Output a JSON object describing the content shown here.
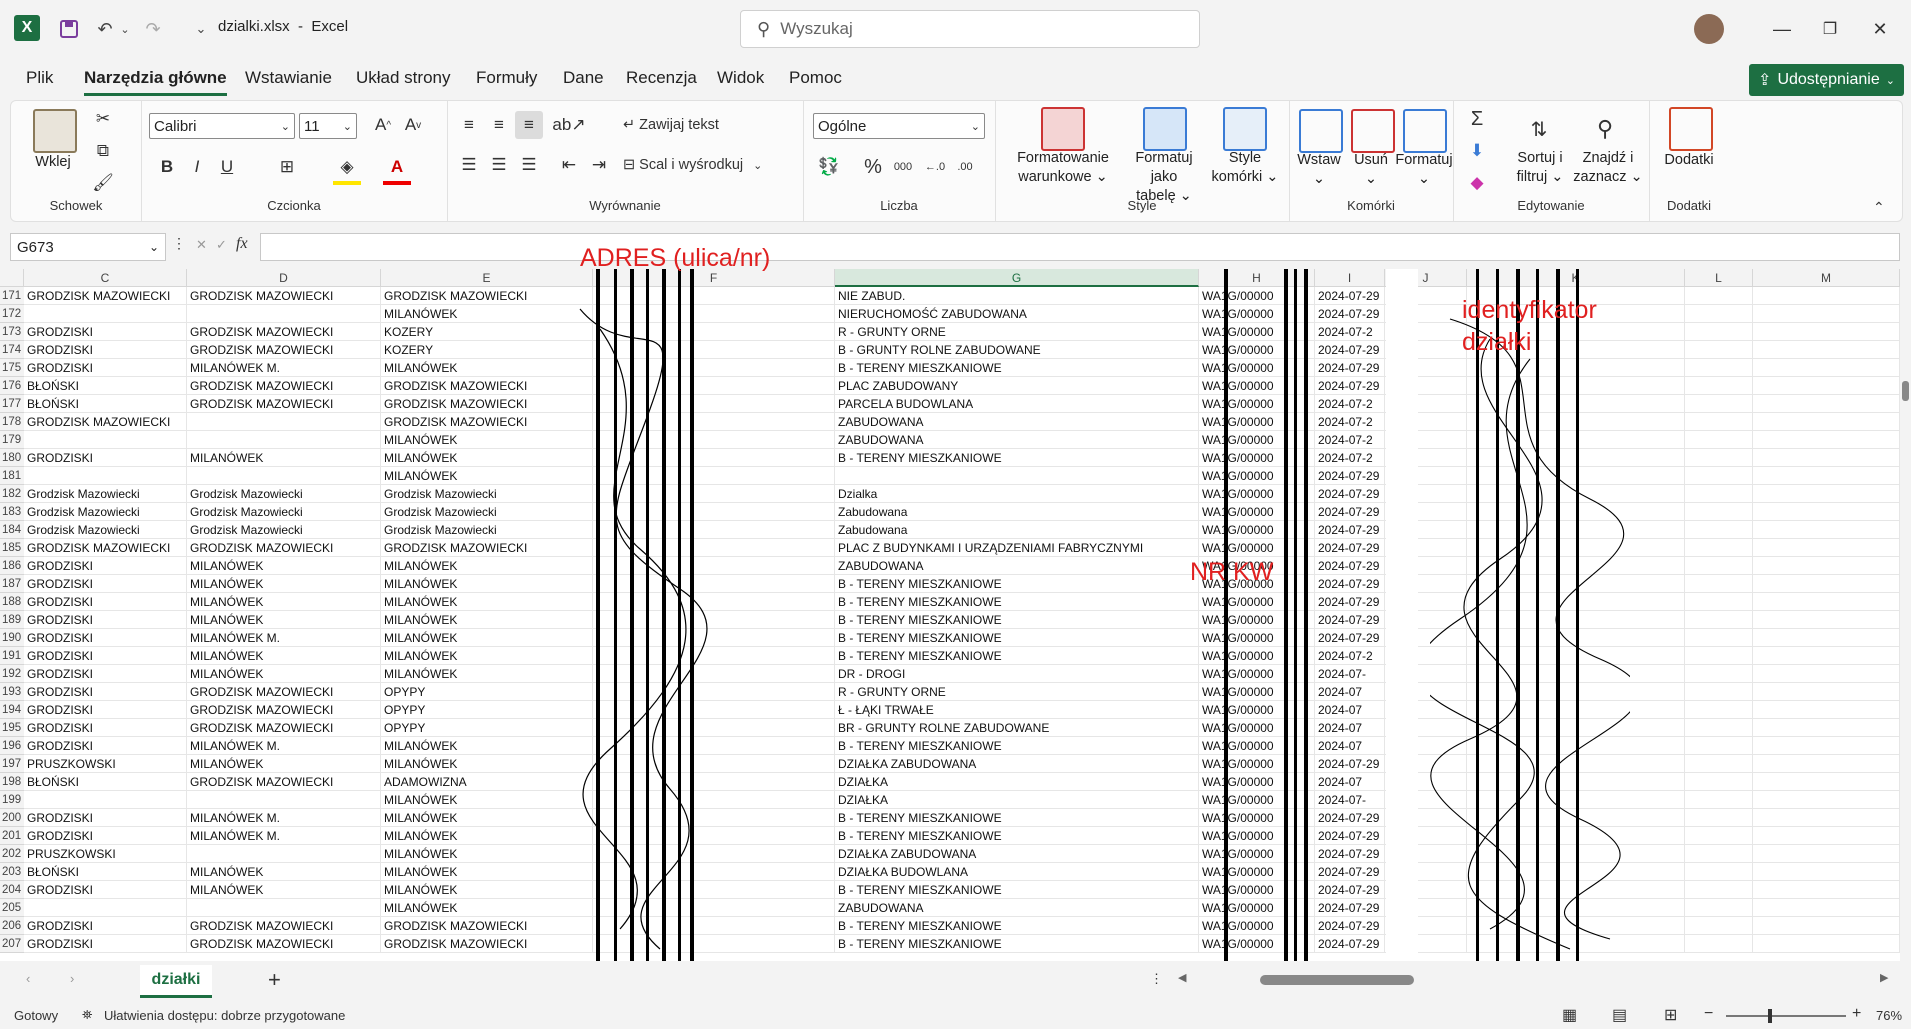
{
  "app": {
    "logo": "X",
    "file_name": "dzialki.xlsx",
    "separator": "-",
    "app_name": "Excel",
    "search_placeholder": "Wyszukaj",
    "accent": "#1d6f42"
  },
  "icons": {
    "save": "save-icon",
    "undo": "undo-icon",
    "redo": "redo-icon",
    "search": "search-icon"
  },
  "menu_tabs": [
    "Plik",
    "Narzędzia główne",
    "Wstawianie",
    "Układ strony",
    "Formuły",
    "Dane",
    "Recenzja",
    "Widok",
    "Pomoc"
  ],
  "active_tab": "Narzędzia główne",
  "share_label": "Udostępnianie",
  "ribbon": {
    "schowek": {
      "label": "Schowek",
      "paste": "Wklej"
    },
    "czcionka": {
      "label": "Czcionka",
      "font": "Calibri",
      "size": "11",
      "bold": "B",
      "italic": "I",
      "underline": "U"
    },
    "wyrownanie": {
      "label": "Wyrównanie",
      "wrap": "Zawijaj tekst",
      "merge": "Scal i wyśrodkuj"
    },
    "liczba": {
      "label": "Liczba",
      "format": "Ogólne",
      "percent": "%",
      "thousands": "000"
    },
    "style": {
      "label": "Style",
      "cond": [
        "Formatowanie",
        "warunkowe"
      ],
      "table": [
        "Formatuj jako",
        "tabelę"
      ],
      "cell": [
        "Style",
        "komórki"
      ]
    },
    "komorki": {
      "label": "Komórki",
      "insert": "Wstaw",
      "delete": "Usuń",
      "format": "Formatuj"
    },
    "edytowanie": {
      "label": "Edytowanie",
      "sort": [
        "Sortuj i",
        "filtruj"
      ],
      "find": [
        "Znajdź i",
        "zaznacz"
      ]
    },
    "dodatki": {
      "label": "Dodatki",
      "addins": "Dodatki"
    }
  },
  "formula_bar": {
    "name_box": "G673",
    "fx": "fx",
    "cancel": "✕",
    "enter": "✓"
  },
  "columns": [
    "C",
    "D",
    "E",
    "F",
    "G",
    "H",
    "I",
    "J",
    "K",
    "L",
    "M"
  ],
  "rows": [
    {
      "n": "171",
      "c": "GRODZISK MAZOWIECKI",
      "d": "GRODZISK MAZOWIECKI",
      "e": "GRODZISK MAZOWIECKI",
      "g": "NIE ZABUD.",
      "h": "WA1G/00000",
      "i": "2024-07-29"
    },
    {
      "n": "172",
      "c": "",
      "d": "",
      "e": "MILANÓWEK",
      "g": "NIERUCHOMOŚĆ ZABUDOWANA",
      "h": "WA1G/00000",
      "i": "2024-07-29"
    },
    {
      "n": "173",
      "c": "GRODZISKI",
      "d": "GRODZISK MAZOWIECKI",
      "e": "KOZERY",
      "g": "R - GRUNTY ORNE",
      "h": "WA1G/00000",
      "i": "2024-07-2"
    },
    {
      "n": "174",
      "c": "GRODZISKI",
      "d": "GRODZISK MAZOWIECKI",
      "e": "KOZERY",
      "g": "B - GRUNTY ROLNE ZABUDOWANE",
      "h": "WA1G/00000",
      "i": "2024-07-29"
    },
    {
      "n": "175",
      "c": "GRODZISKI",
      "d": "MILANÓWEK M.",
      "e": "MILANÓWEK",
      "g": "B - TERENY MIESZKANIOWE",
      "h": "WA1G/00000",
      "i": "2024-07-29"
    },
    {
      "n": "176",
      "c": "BŁOŃSKI",
      "d": "GRODZISK MAZOWIECKI",
      "e": "GRODZISK MAZOWIECKI",
      "g": "PLAC ZABUDOWANY",
      "h": "WA1G/00000",
      "i": "2024-07-29"
    },
    {
      "n": "177",
      "c": "BŁOŃSKI",
      "d": "GRODZISK MAZOWIECKI",
      "e": "GRODZISK MAZOWIECKI",
      "g": "PARCELA BUDOWLANA",
      "h": "WA1G/00000",
      "i": "2024-07-2"
    },
    {
      "n": "178",
      "c": "GRODZISK MAZOWIECKI",
      "d": "",
      "e": "GRODZISK MAZOWIECKI",
      "g": "ZABUDOWANA",
      "h": "WA1G/00000",
      "i": "2024-07-2"
    },
    {
      "n": "179",
      "c": "",
      "d": "",
      "e": "MILANÓWEK",
      "g": "ZABUDOWANA",
      "h": "WA1G/00000",
      "i": "2024-07-2"
    },
    {
      "n": "180",
      "c": "GRODZISKI",
      "d": "MILANÓWEK",
      "e": "MILANÓWEK",
      "g": "B - TERENY MIESZKANIOWE",
      "h": "WA1G/00000",
      "i": "2024-07-2"
    },
    {
      "n": "181",
      "c": "",
      "d": "",
      "e": "MILANÓWEK",
      "g": "",
      "h": "WA1G/00000",
      "i": "2024-07-29"
    },
    {
      "n": "182",
      "c": "Grodzisk Mazowiecki",
      "d": "Grodzisk Mazowiecki",
      "e": "Grodzisk Mazowiecki",
      "g": "Dzialka",
      "h": "WA1G/00000",
      "i": "2024-07-29"
    },
    {
      "n": "183",
      "c": "Grodzisk Mazowiecki",
      "d": "Grodzisk Mazowiecki",
      "e": "Grodzisk Mazowiecki",
      "g": "Zabudowana",
      "h": "WA1G/00000",
      "i": "2024-07-29"
    },
    {
      "n": "184",
      "c": "Grodzisk Mazowiecki",
      "d": "Grodzisk Mazowiecki",
      "e": "Grodzisk Mazowiecki",
      "g": "Zabudowana",
      "h": "WA1G/00000",
      "i": "2024-07-29"
    },
    {
      "n": "185",
      "c": "GRODZISK MAZOWIECKI",
      "d": "GRODZISK MAZOWIECKI",
      "e": "GRODZISK MAZOWIECKI",
      "g": "PLAC Z BUDYNKAMI I URZĄDZENIAMI FABRYCZNYMI",
      "h": "WA1G/00000",
      "i": "2024-07-29"
    },
    {
      "n": "186",
      "c": "GRODZISKI",
      "d": "MILANÓWEK",
      "e": "MILANÓWEK",
      "g": "ZABUDOWANA",
      "h": "WA1G/00000",
      "i": "2024-07-29"
    },
    {
      "n": "187",
      "c": "GRODZISKI",
      "d": "MILANÓWEK",
      "e": "MILANÓWEK",
      "g": "B - TERENY MIESZKANIOWE",
      "h": "WA1G/00000",
      "i": "2024-07-29"
    },
    {
      "n": "188",
      "c": "GRODZISKI",
      "d": "MILANÓWEK",
      "e": "MILANÓWEK",
      "g": "B - TERENY MIESZKANIOWE",
      "h": "WA1G/00000",
      "i": "2024-07-29"
    },
    {
      "n": "189",
      "c": "GRODZISKI",
      "d": "MILANÓWEK",
      "e": "MILANÓWEK",
      "g": "B - TERENY MIESZKANIOWE",
      "h": "WA1G/00000",
      "i": "2024-07-29"
    },
    {
      "n": "190",
      "c": "GRODZISKI",
      "d": "MILANÓWEK M.",
      "e": "MILANÓWEK",
      "g": "B - TERENY MIESZKANIOWE",
      "h": "WA1G/00000",
      "i": "2024-07-29"
    },
    {
      "n": "191",
      "c": "GRODZISKI",
      "d": "MILANÓWEK",
      "e": "MILANÓWEK",
      "g": "B - TERENY MIESZKANIOWE",
      "h": "WA1G/00000",
      "i": "2024-07-2"
    },
    {
      "n": "192",
      "c": "GRODZISKI",
      "d": "MILANÓWEK",
      "e": "MILANÓWEK",
      "g": "DR - DROGI",
      "h": "WA1G/00000",
      "i": "2024-07-"
    },
    {
      "n": "193",
      "c": "GRODZISKI",
      "d": "GRODZISK MAZOWIECKI",
      "e": "OPYPY",
      "g": "R - GRUNTY ORNE",
      "h": "WA1G/00000",
      "i": "2024-07"
    },
    {
      "n": "194",
      "c": "GRODZISKI",
      "d": "GRODZISK MAZOWIECKI",
      "e": "OPYPY",
      "g": "Ł - ŁĄKI TRWAŁE",
      "h": "WA1G/00000",
      "i": "2024-07"
    },
    {
      "n": "195",
      "c": "GRODZISKI",
      "d": "GRODZISK MAZOWIECKI",
      "e": "OPYPY",
      "g": "BR - GRUNTY ROLNE ZABUDOWANE",
      "h": "WA1G/00000",
      "i": "2024-07"
    },
    {
      "n": "196",
      "c": "GRODZISKI",
      "d": "MILANÓWEK M.",
      "e": "MILANÓWEK",
      "g": "B - TERENY MIESZKANIOWE",
      "h": "WA1G/00000",
      "i": "2024-07"
    },
    {
      "n": "197",
      "c": "PRUSZKOWSKI",
      "d": "MILANÓWEK",
      "e": "MILANÓWEK",
      "g": "DZIAŁKA ZABUDOWANA",
      "h": "WA1G/00000",
      "i": "2024-07-29"
    },
    {
      "n": "198",
      "c": "BŁOŃSKI",
      "d": "GRODZISK MAZOWIECKI",
      "e": "ADAMOWIZNA",
      "g": "DZIAŁKA",
      "h": "WA1G/00000",
      "i": "2024-07"
    },
    {
      "n": "199",
      "c": "",
      "d": "",
      "e": "MILANÓWEK",
      "g": "DZIAŁKA",
      "h": "WA1G/00000",
      "i": "2024-07-"
    },
    {
      "n": "200",
      "c": "GRODZISKI",
      "d": "MILANÓWEK M.",
      "e": "MILANÓWEK",
      "g": "B - TERENY MIESZKANIOWE",
      "h": "WA1G/00000",
      "i": "2024-07-29"
    },
    {
      "n": "201",
      "c": "GRODZISKI",
      "d": "MILANÓWEK M.",
      "e": "MILANÓWEK",
      "g": "B - TERENY MIESZKANIOWE",
      "h": "WA1G/00000",
      "i": "2024-07-29"
    },
    {
      "n": "202",
      "c": "PRUSZKOWSKI",
      "d": "",
      "e": "MILANÓWEK",
      "g": "DZIAŁKA ZABUDOWANA",
      "h": "WA1G/00000",
      "i": "2024-07-29"
    },
    {
      "n": "203",
      "c": "BŁOŃSKI",
      "d": "MILANÓWEK",
      "e": "MILANÓWEK",
      "g": "DZIAŁKA BUDOWLANA",
      "h": "WA1G/00000",
      "i": "2024-07-29"
    },
    {
      "n": "204",
      "c": "GRODZISKI",
      "d": "MILANÓWEK",
      "e": "MILANÓWEK",
      "g": "B - TERENY MIESZKANIOWE",
      "h": "WA1G/00000",
      "i": "2024-07-29"
    },
    {
      "n": "205",
      "c": "",
      "d": "",
      "e": "MILANÓWEK",
      "g": "ZABUDOWANA",
      "h": "WA1G/00000",
      "i": "2024-07-29"
    },
    {
      "n": "206",
      "c": "GRODZISKI",
      "d": "GRODZISK MAZOWIECKI",
      "e": "GRODZISK MAZOWIECKI",
      "g": "B - TERENY MIESZKANIOWE",
      "h": "WA1G/00000",
      "i": "2024-07-29"
    },
    {
      "n": "207",
      "c": "GRODZISKI",
      "d": "GRODZISK MAZOWIECKI",
      "e": "GRODZISK MAZOWIECKI",
      "g": "B - TERENY MIESZKANIOWE",
      "h": "WA1G/00000",
      "i": "2024-07-29"
    }
  ],
  "annotations": {
    "address": "ADRES (ulica/nr)",
    "kw": "NR KW",
    "identifier_line1": "identyfikator",
    "identifier_line2": "działki"
  },
  "sheet_tabs": [
    "działki"
  ],
  "status": {
    "ready": "Gotowy",
    "accessibility": "Ułatwienia dostępu: dobrze przygotowane",
    "zoom": "76%"
  }
}
